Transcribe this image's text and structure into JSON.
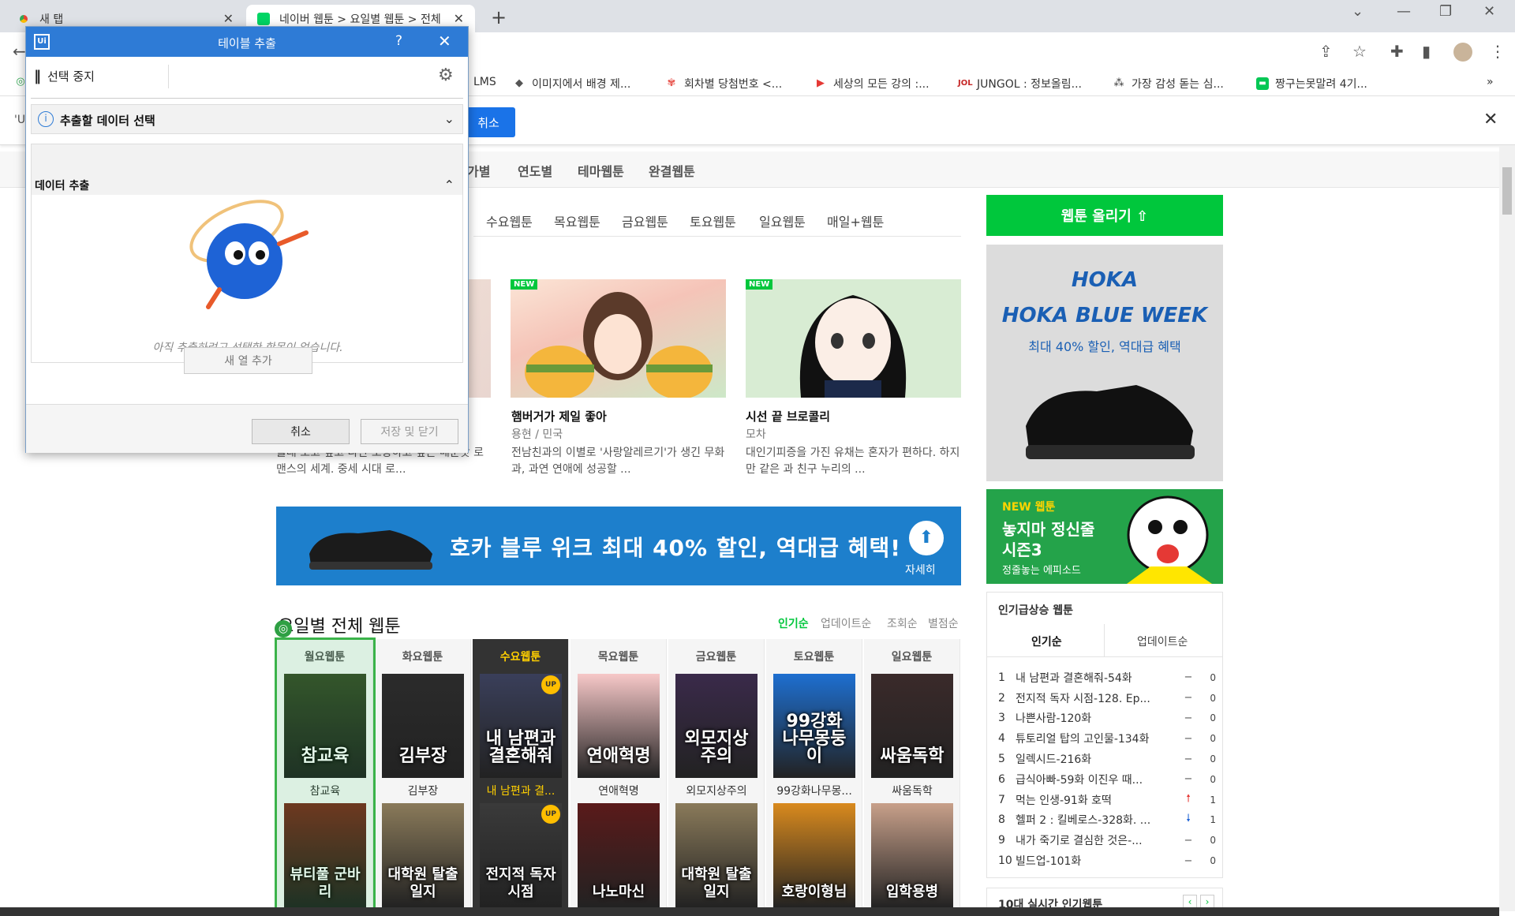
{
  "browser": {
    "tabs": [
      {
        "title": "새 탭",
        "active": false
      },
      {
        "title": "네이버 웹툰 > 요일별 웹툰 > 전체",
        "active": true
      }
    ],
    "new_tab": "+",
    "bookmarks": [
      "LMS",
      "이미지에서 배경 제...",
      "회차별 당첨번호 <...",
      "세상의 모든 강의 :...",
      "JUNGOL : 정보올림...",
      "가장 감성 돋는 심...",
      "짱구는못말려 4기..."
    ],
    "bookmarks_more": "»"
  },
  "extension_bar": {
    "cancel_label": "취소",
    "close_label": "✕"
  },
  "dialog": {
    "title": "테이블 추출",
    "help": "?",
    "close": "✕",
    "stop_label": "선택 중지",
    "section1": "추출할 데이터 선택",
    "section2": "데이터 추출",
    "empty_message": "아직 추출하려고 선택한 항목이 없습니다.",
    "add_column": "새 열 추가",
    "cancel": "취소",
    "save_close": "저장 및 닫기"
  },
  "page": {
    "subnav": [
      "가별",
      "연도별",
      "테마웹툰",
      "완결웹툰"
    ],
    "day_tabs": [
      "수요웹툰",
      "목요웹툰",
      "금요웹툰",
      "토요웹툰",
      "일요웹툰",
      "매일+웹툰"
    ],
    "featured": [
      {
        "desc": "몰래 보고 싶고 나만 소장하고 싶은 매운맛 로맨스의 세계. 중세 시대 로..."
      },
      {
        "title": "햄버거가 제일 좋아",
        "author": "용현 / 민국",
        "desc": "전남친과의 이별로 '사랑알레르기'가 생긴 무화과, 과연 연애에 성공할 ...",
        "new": "NEW"
      },
      {
        "title": "시선 끝 브로콜리",
        "author": "모차",
        "desc": "대인기피증을 가진 유채는 혼자가 편하다. 하지만 같은 과 친구 누리의 ...",
        "new": "NEW"
      }
    ],
    "banner": {
      "text": "호카 블루 위크 최대 40% 할인, 역대급 혜택!",
      "more": "자세히",
      "shoe_text": "HOKA"
    },
    "section_title": "요일별 전체 웹툰",
    "sort": [
      "인기순",
      "업데이트순",
      "조회순",
      "별점순"
    ],
    "days": [
      {
        "head": "월요웹툰",
        "items": [
          "참교육",
          ""
        ],
        "overlays": [
          "참교육",
          "뷰티풀 군바리"
        ]
      },
      {
        "head": "화요웹툰",
        "items": [
          "김부장",
          ""
        ],
        "overlays": [
          "김부장",
          "대학원 탈출일지"
        ]
      },
      {
        "head": "수요웹툰",
        "items": [
          "내 남편과 결...",
          ""
        ],
        "overlays": [
          "내 남편과 결혼해줘",
          "전지적 독자 시점"
        ],
        "up": "UP"
      },
      {
        "head": "목요웹툰",
        "items": [
          "연애혁명",
          ""
        ],
        "overlays": [
          "연애혁명",
          "나노마신"
        ]
      },
      {
        "head": "금요웹툰",
        "items": [
          "외모지상주의",
          ""
        ],
        "overlays": [
          "외모지상주의",
          "대학원 탈출일지"
        ]
      },
      {
        "head": "토요웹툰",
        "items": [
          "99강화나무몽...",
          ""
        ],
        "overlays": [
          "99강화 나무몽둥이",
          "호랑이형님"
        ]
      },
      {
        "head": "일요웹툰",
        "items": [
          "싸움독학",
          ""
        ],
        "overlays": [
          "싸움독학",
          "입학용병"
        ]
      }
    ],
    "target_icon": "◎"
  },
  "sidebar": {
    "upload": "웹툰 올리기 ⇧",
    "ad1": {
      "brand": "HOKA",
      "headline": "HOKA BLUE WEEK",
      "sub": "최대 40% 할인, 역대급 혜택"
    },
    "ad2": {
      "tag": "NEW 웹툰",
      "title_line1": "놓지마 정신줄",
      "title_line2": "시즌3",
      "sub": "정줄놓는 에피소드"
    },
    "rank_title": "인기급상승 웹툰",
    "rank_tabs": [
      "인기순",
      "업데이트순"
    ],
    "ranks": [
      {
        "n": "1",
        "t": "내 남편과 결혼해줘-54화",
        "ch": "−",
        "c": "0"
      },
      {
        "n": "2",
        "t": "전지적 독자 시점-128. Ep...",
        "ch": "−",
        "c": "0"
      },
      {
        "n": "3",
        "t": "나쁜사람-120화",
        "ch": "−",
        "c": "0"
      },
      {
        "n": "4",
        "t": "튜토리얼 탑의 고인물-134화",
        "ch": "−",
        "c": "0"
      },
      {
        "n": "5",
        "t": "일렉시드-216화",
        "ch": "−",
        "c": "0"
      },
      {
        "n": "6",
        "t": "급식아빠-59화 이진우 때...",
        "ch": "−",
        "c": "0"
      },
      {
        "n": "7",
        "t": "먹는 인생-91화 호떡",
        "ch": "🠕",
        "c": "1"
      },
      {
        "n": "8",
        "t": "헬퍼 2 : 킬베로스-328화. ...",
        "ch": "🠗",
        "c": "1"
      },
      {
        "n": "9",
        "t": "내가 죽기로 결심한 것은-...",
        "ch": "−",
        "c": "0"
      },
      {
        "n": "10",
        "t": "빌드업-101화",
        "ch": "−",
        "c": "0"
      }
    ],
    "rank2_title": "10대 실시간 인기웹툰"
  },
  "colors": {
    "naver_green": "#00c73c",
    "dialog_blue": "#2e7bd6",
    "today_yellow": "#ffcf00"
  }
}
